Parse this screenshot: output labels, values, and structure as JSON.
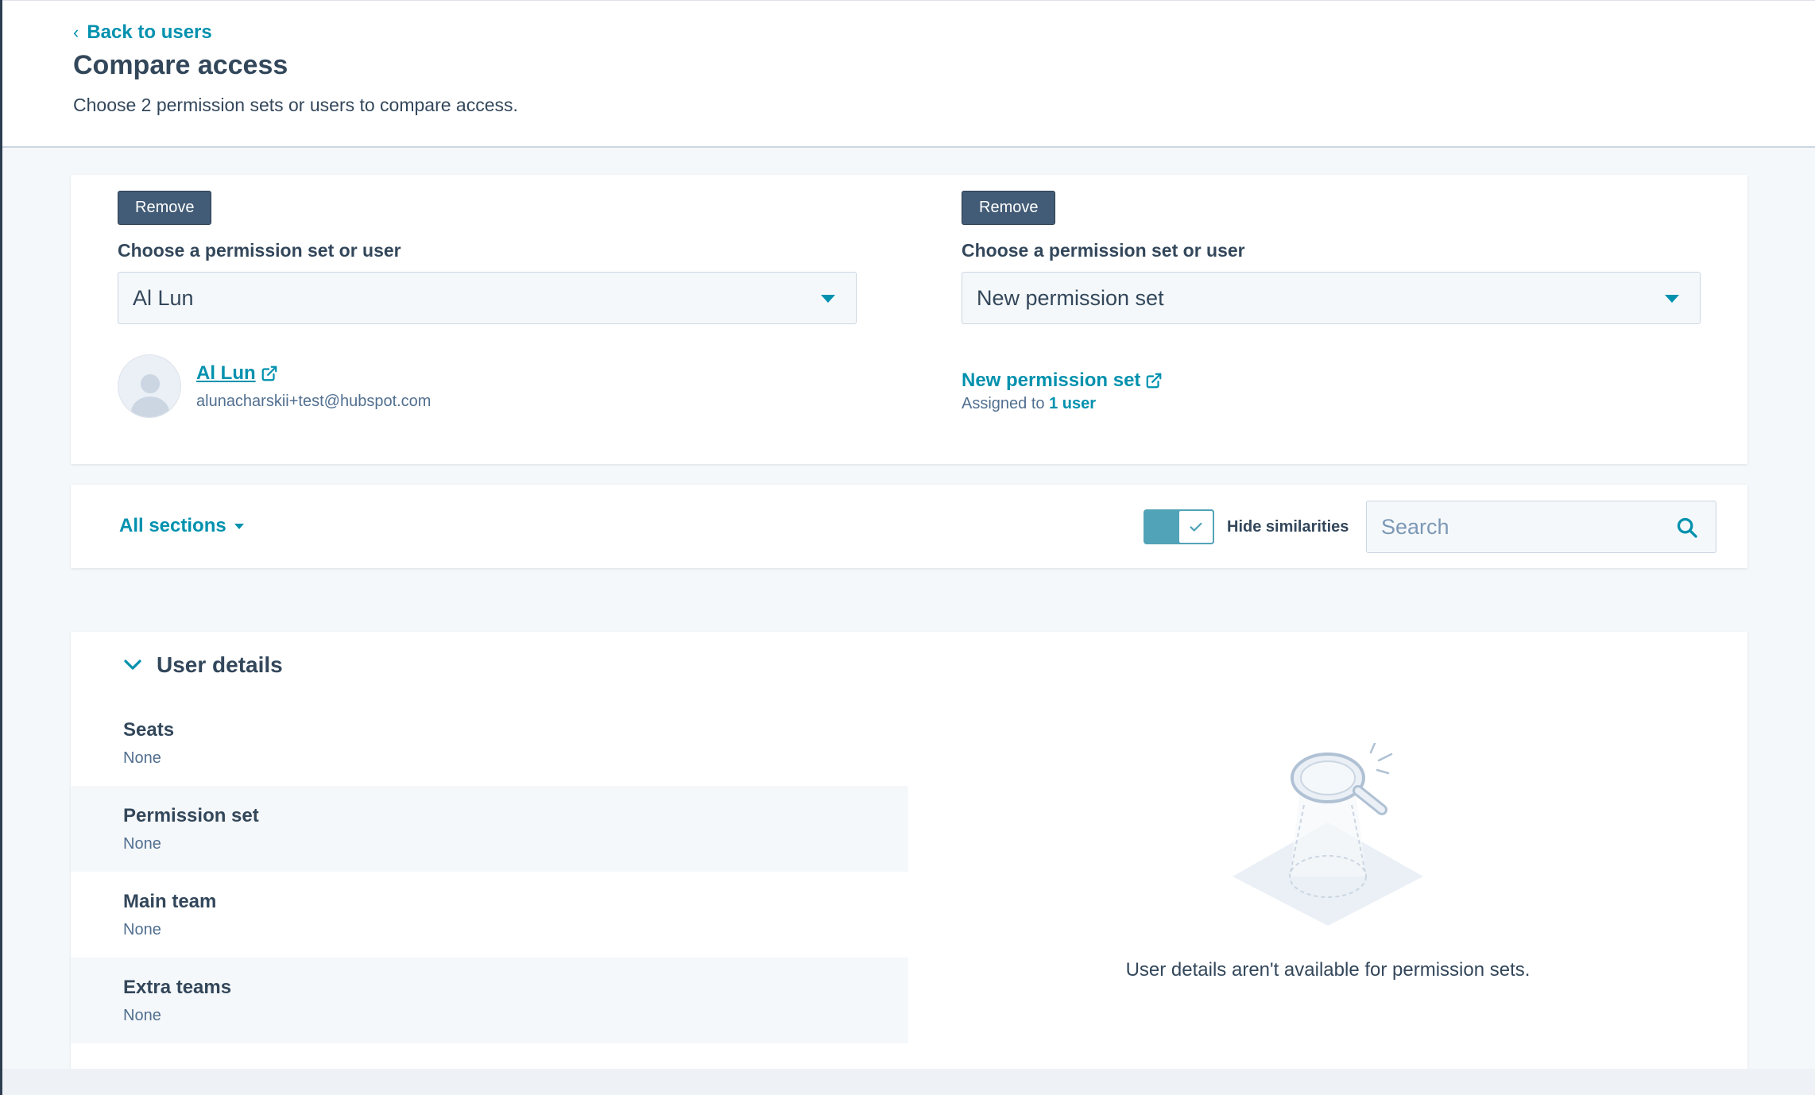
{
  "header": {
    "back_link": "Back to users",
    "title": "Compare access",
    "subtitle": "Choose 2 permission sets or users to compare access."
  },
  "compare": {
    "left": {
      "remove_label": "Remove",
      "select_label": "Choose a permission set or user",
      "selected_value": "Al Lun",
      "user": {
        "name": "Al Lun",
        "email": "alunacharskii+test@hubspot.com"
      }
    },
    "right": {
      "remove_label": "Remove",
      "select_label": "Choose a permission set or user",
      "selected_value": "New permission set",
      "permission_set": {
        "name": "New permission set",
        "assigned_prefix": "Assigned to",
        "assigned_count": "1 user"
      }
    }
  },
  "filter_bar": {
    "sections_label": "All sections",
    "toggle_label": "Hide similarities",
    "toggle_on": true,
    "search_placeholder": "Search"
  },
  "user_details": {
    "title": "User details",
    "rows": [
      {
        "label": "Seats",
        "value": "None"
      },
      {
        "label": "Permission set",
        "value": "None"
      },
      {
        "label": "Main team",
        "value": "None"
      },
      {
        "label": "Extra teams",
        "value": "None"
      }
    ],
    "empty_message": "User details aren't available for permission sets."
  },
  "colors": {
    "link": "#0091ae",
    "text": "#33475b",
    "button": "#425b76",
    "toggle": "#51a3b7"
  },
  "icons": {
    "back": "chevron-left-icon",
    "external": "external-link-icon",
    "dropdown": "caret-down-icon",
    "search": "search-icon",
    "section": "chevron-down-icon",
    "empty": "magnifier-illustration"
  }
}
